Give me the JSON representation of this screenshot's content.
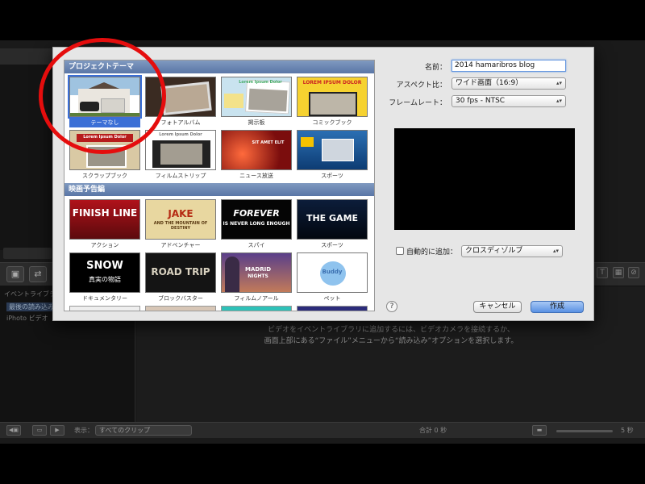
{
  "background_app": {
    "sidebar_header": "イベントライブラリ",
    "sidebar_items": [
      "最後の読み込み",
      "iPhoto ビデオ"
    ],
    "empty_message_line1": "ビデオをイベントライブラリに追加するには、ビデオカメラを接続するか、",
    "empty_message_line2": "画面上部にある“ファイル”メニューから“読み込み”オプションを選択します。",
    "bottom_show_label": "表示：",
    "bottom_show_value": "すべてのクリップ",
    "bottom_total": "合計 0 秒",
    "bottom_zoom": "5 秒"
  },
  "dialog": {
    "theme_section_title": "プロジェクトテーマ",
    "trailer_section_title": "映画予告編",
    "themes": [
      {
        "label": "テーマなし",
        "selected": true
      },
      {
        "label": "フォトアルバム"
      },
      {
        "label": "掲示板"
      },
      {
        "label": "コミックブック"
      },
      {
        "label": "スクラップブック"
      },
      {
        "label": "フィルムストリップ"
      },
      {
        "label": "ニュース放送"
      },
      {
        "label": "スポーツ"
      }
    ],
    "theme_thumb_texts": {
      "bulletin": "Lorem Ipsum Dolor",
      "comic": "LOREM IPSUM DOLOR",
      "scrapbook": "Lorem Ipsum Dolor",
      "news": "SIT AMET ELIT",
      "filmstrip": "Lorem Ipsum Dolor"
    },
    "trailers": [
      {
        "label": "アクション",
        "thumb_text": "FINISH LINE"
      },
      {
        "label": "アドベンチャー",
        "thumb_text": "JAKE",
        "thumb_sub": "AND THE MOUNTAIN OF DESTINY"
      },
      {
        "label": "スパイ",
        "thumb_text": "FOREVER",
        "thumb_sub": "IS NEVER LONG ENOUGH"
      },
      {
        "label": "スポーツ",
        "thumb_text": "THE GAME"
      },
      {
        "label": "ドキュメンタリー",
        "thumb_text": "SNOW",
        "thumb_sub": "真実の物語"
      },
      {
        "label": "ブロックバスター",
        "thumb_text": "ROAD TRIP"
      },
      {
        "label": "フィルムノアール",
        "thumb_text": "MADRID",
        "thumb_sub": "NIGHTS"
      },
      {
        "label": "ペット",
        "thumb_text": "Buddy"
      }
    ],
    "name_label": "名前：",
    "name_value": "2014 hamaribros blog",
    "aspect_label": "アスペクト比：",
    "aspect_value": "ワイド画面（16:9）",
    "framerate_label": "フレームレート：",
    "framerate_value": "30 fps - NTSC",
    "auto_add_label": "自動的に追加：",
    "auto_add_value": "クロスディゾルブ",
    "help_label": "?",
    "cancel_label": "キャンセル",
    "create_label": "作成"
  },
  "colors": {
    "selection_blue": "#3b6fd6",
    "annotation_red": "#e50d0d",
    "section_header": "#6a85b3"
  }
}
